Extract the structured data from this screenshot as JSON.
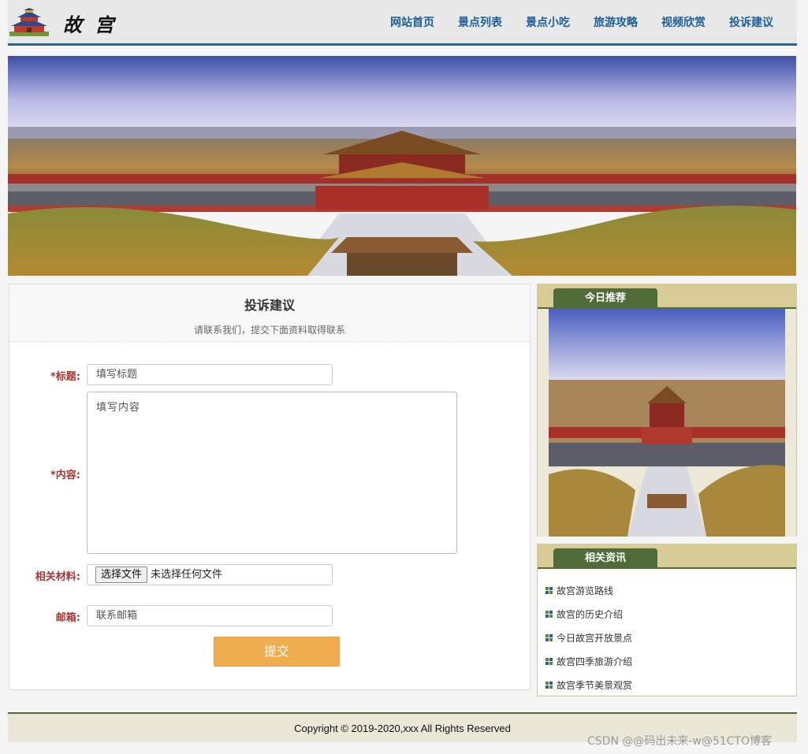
{
  "header": {
    "site_title": "故 宫",
    "nav": [
      "网站首页",
      "景点列表",
      "景点小吃",
      "旅游攻略",
      "视频欣赏",
      "投诉建议"
    ]
  },
  "form": {
    "title": "投诉建议",
    "subtitle": "请联系我们，提交下面资料取得联系",
    "fields": {
      "title_label": "*标题:",
      "title_placeholder": "填写标题",
      "content_label": "*内容:",
      "content_placeholder": "填写内容",
      "file_label": "相关材料:",
      "file_button": "选择文件",
      "file_status": "未选择任何文件",
      "email_label": "邮箱:",
      "email_placeholder": "联系邮箱"
    },
    "submit_label": "提交"
  },
  "sidebar": {
    "today_title": "今日推荐",
    "news_title": "相关资讯",
    "news_items": [
      "故宫游览路线",
      "故宫的历史介绍",
      "今日故宫开放景点",
      "故宫四季旅游介绍",
      "故宫季节美景观赏"
    ]
  },
  "footer": {
    "copyright": "Copyright © 2019-2020,xxx All Rights Reserved"
  },
  "watermark": "CSDN @@码出未来-w@51CTO博客"
}
